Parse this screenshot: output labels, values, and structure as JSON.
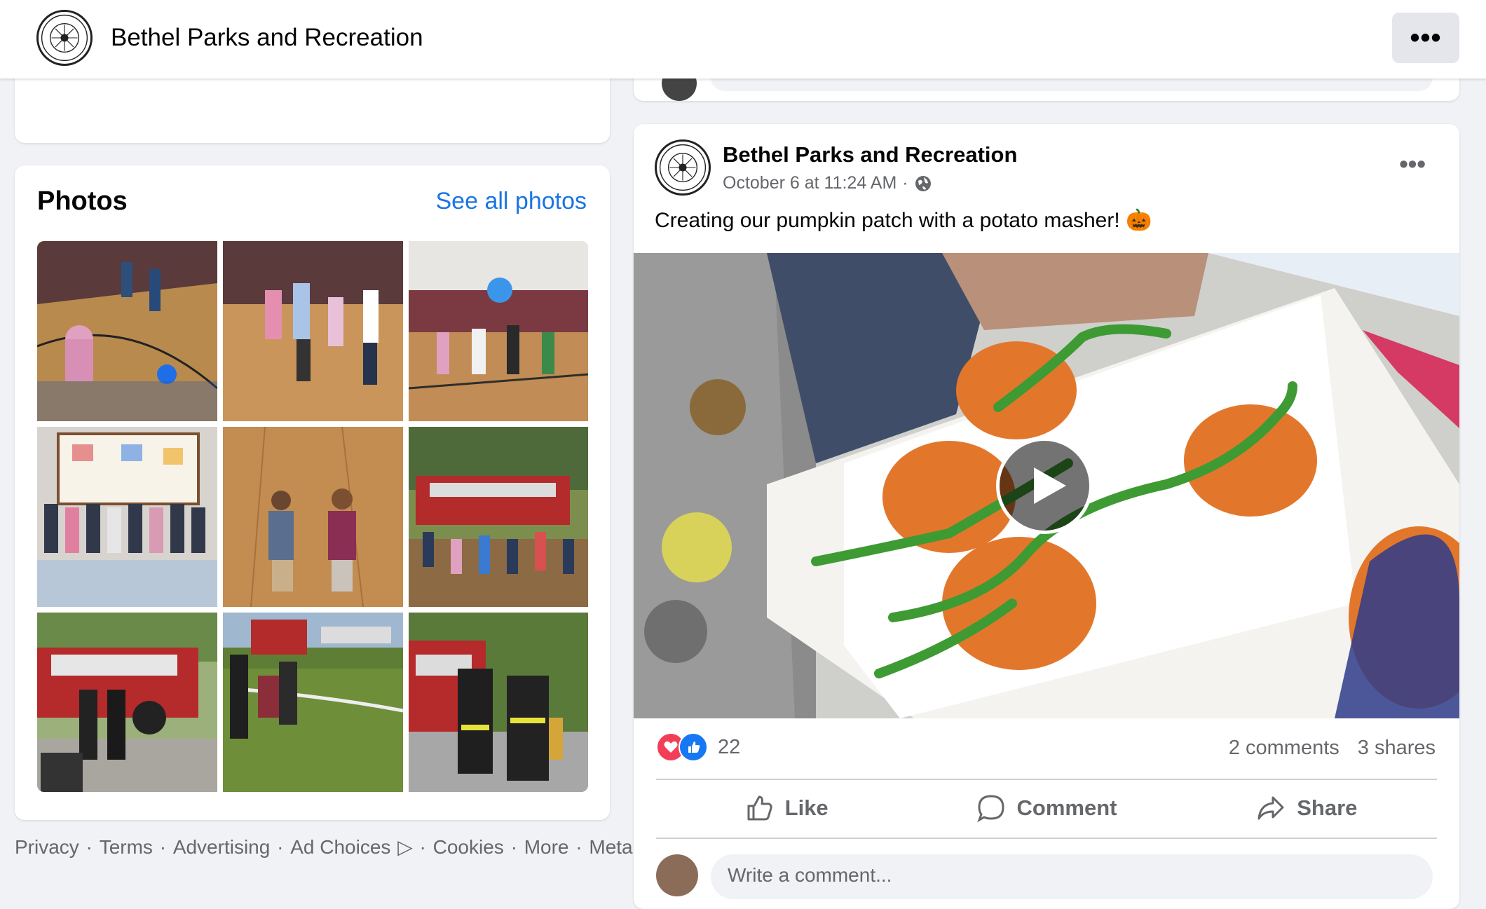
{
  "header": {
    "page_name": "Bethel Parks and Recreation",
    "more_icon": "more-dots-icon"
  },
  "photos": {
    "title": "Photos",
    "see_all": "See all photos",
    "count": 9
  },
  "footer": {
    "links": [
      "Privacy",
      "Terms",
      "Advertising",
      "Ad Choices",
      "Cookies",
      "More",
      "Meta ©"
    ],
    "separator": " · "
  },
  "post": {
    "author": "Bethel Parks and Recreation",
    "timestamp": "October 6 at 11:24 AM",
    "separator": "·",
    "audience_icon": "globe-icon",
    "text": "Creating our pumpkin patch with a potato masher! 🎃",
    "reaction_count": "22",
    "comments": "2 comments",
    "shares": "3 shares",
    "actions": {
      "like": "Like",
      "comment": "Comment",
      "share": "Share"
    },
    "comment_placeholder": "Write a comment..."
  },
  "colors": {
    "link": "#1b74e4",
    "secondary_text": "#65676b",
    "like_blue": "#1877f2",
    "love_red": "#f33e58"
  }
}
